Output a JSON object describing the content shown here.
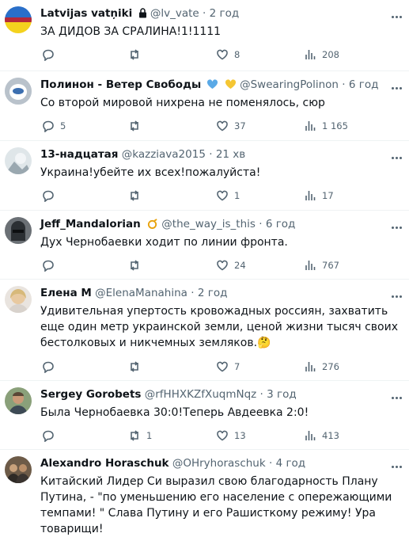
{
  "tweets": [
    {
      "name": "Latvijas vatņiki",
      "handle": "@lv_vate",
      "time": "2 год",
      "text": "ЗА ДИДОВ ЗА СРАЛИНА!1!1111",
      "replies": "",
      "retweets": "",
      "likes": "8",
      "views": "208",
      "avatar": "flag"
    },
    {
      "name": "Полинон - Ветер Свободы",
      "handle": "@SwearingPolinon",
      "time": "6 год",
      "text": "Со второй мировой нихрена не поменялось, сюр",
      "replies": "5",
      "retweets": "",
      "likes": "37",
      "views": "1 165",
      "avatar": "cup"
    },
    {
      "name": "13-надцатая",
      "handle": "@kazziava2015",
      "time": "21 хв",
      "text": "Украина!убейте их всех!пожалуйста!",
      "replies": "",
      "retweets": "",
      "likes": "1",
      "views": "17",
      "avatar": "photo"
    },
    {
      "name": "Jeff_Mandalorian",
      "handle": "@the_way_is_this",
      "time": "6 год",
      "text": "Дух Чернобаевки ходит по линии фронта.",
      "replies": "",
      "retweets": "",
      "likes": "24",
      "views": "767",
      "avatar": "helmet"
    },
    {
      "name": "Елена М",
      "handle": "@ElenaManahina",
      "time": "2 год",
      "text": "Удивительная упертость кровожадных россиян, захватить еще один метр украинской земли, ценой жизни тысяч своих бестолковых и никчемных земляков.🤔",
      "replies": "",
      "retweets": "",
      "likes": "7",
      "views": "276",
      "avatar": "woman"
    },
    {
      "name": "Sergey Gorobets",
      "handle": "@rfHHXKZfXuqmNqz",
      "time": "3 год",
      "text": "Была Чернобаевка 30:0!Теперь Авдеевка 2:0!",
      "replies": "",
      "retweets": "1",
      "likes": "13",
      "views": "413",
      "avatar": "man"
    },
    {
      "name": "Alexandro Horaschuk",
      "handle": "@OHryhoraschuk",
      "time": "4 год",
      "text": "Китайский Лидер Си выразил свою благодарность Плану Путина, - \"по уменьшению его население с опережающими темпами! \" Слава Путину и его Рашисткому режиму! Ура товарищи!",
      "replies": "",
      "retweets": "",
      "likes": "",
      "views": "",
      "avatar": "group"
    }
  ],
  "colors": {
    "text": "#0f1419",
    "muted": "#536471",
    "divider": "#eff3f4"
  }
}
